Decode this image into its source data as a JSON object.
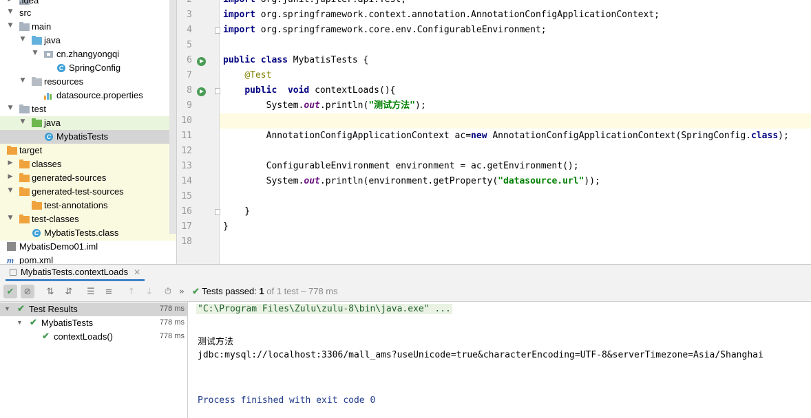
{
  "project_tree": [
    {
      "label": ".idea",
      "icon": "folder-icon",
      "expanded": false
    },
    {
      "label": "src",
      "icon": "folder-icon",
      "expanded": true
    },
    {
      "label": "main",
      "icon": "folder-icon",
      "expanded": true
    },
    {
      "label": "java",
      "icon": "source-folder-icon",
      "expanded": true
    },
    {
      "label": "cn.zhangyongqi",
      "icon": "package-icon",
      "expanded": true
    },
    {
      "label": "SpringConfig",
      "icon": "class-icon"
    },
    {
      "label": "resources",
      "icon": "resources-folder-icon",
      "expanded": true
    },
    {
      "label": "datasource.properties",
      "icon": "properties-file-icon"
    },
    {
      "label": "test",
      "icon": "folder-icon",
      "expanded": true
    },
    {
      "label": "java",
      "icon": "test-source-folder-icon",
      "expanded": true
    },
    {
      "label": "MybatisTests",
      "icon": "test-class-icon"
    },
    {
      "label": "target",
      "icon": "excluded-folder-icon",
      "expanded": true
    },
    {
      "label": "classes",
      "icon": "excluded-folder-icon",
      "expanded": false
    },
    {
      "label": "generated-sources",
      "icon": "excluded-folder-icon",
      "expanded": false
    },
    {
      "label": "generated-test-sources",
      "icon": "excluded-folder-icon",
      "expanded": true
    },
    {
      "label": "test-annotations",
      "icon": "excluded-folder-icon"
    },
    {
      "label": "test-classes",
      "icon": "excluded-folder-icon",
      "expanded": true
    },
    {
      "label": "MybatisTests.class",
      "icon": "compiled-class-icon"
    },
    {
      "label": "MybatisDemo01.iml",
      "icon": "module-file-icon"
    },
    {
      "label": "pom.xml",
      "icon": "maven-icon"
    }
  ],
  "editor": {
    "line_numbers": [
      "2",
      "3",
      "4",
      "5",
      "6",
      "7",
      "8",
      "9",
      "10",
      "11",
      "12",
      "13",
      "14",
      "15",
      "16",
      "17",
      "18"
    ],
    "lines": [
      "import org.junit.jupiter.api.Test;",
      "import org.springframework.context.annotation.AnnotationConfigApplicationContext;",
      "import org.springframework.core.env.ConfigurableEnvironment;",
      "",
      "public class MybatisTests {",
      "    @Test",
      "    public  void contextLoads(){",
      "        System.out.println(\"测试方法\");",
      "",
      "        AnnotationConfigApplicationContext ac=new AnnotationConfigApplicationContext(SpringConfig.class);",
      "",
      "        ConfigurableEnvironment environment = ac.getEnvironment();",
      "        System.out.println(environment.getProperty(\"datasource.url\"));",
      "",
      "    }",
      "}",
      ""
    ],
    "current_line": "10"
  },
  "run_panel": {
    "tab_label": "MybatisTests.contextLoads",
    "status_prefix": "Tests passed:",
    "status_count": "1",
    "status_suffix": "of 1 test – 778 ms",
    "results": [
      {
        "label": "Test Results",
        "time": "778 ms"
      },
      {
        "label": "MybatisTests",
        "time": "778 ms"
      },
      {
        "label": "contextLoads()",
        "time": "778 ms"
      }
    ],
    "console": {
      "command": "\"C:\\Program Files\\Zulu\\zulu-8\\bin\\java.exe\" ...",
      "output_1": "测试方法",
      "output_2": "jdbc:mysql://localhost:3306/mall_ams?useUnicode=true&characterEncoding=UTF-8&serverTimezone=Asia/Shanghai",
      "exit": "Process finished with exit code 0"
    }
  },
  "colors": {
    "keyword": "#000080",
    "annotation": "#808000",
    "string": "#008000",
    "static_field": "#660e7a",
    "pass_green": "#499c54",
    "tab_underline": "#4083c9"
  }
}
